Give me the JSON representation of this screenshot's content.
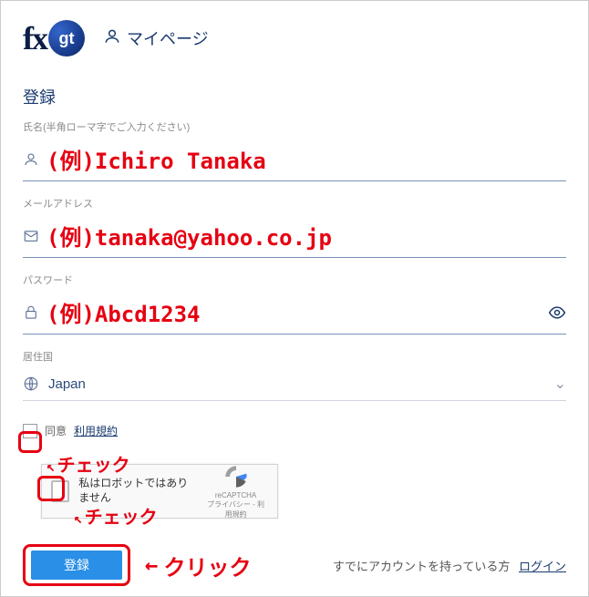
{
  "header": {
    "logo_fx": "fx",
    "logo_gt": "gt",
    "mypage_label": "マイページ"
  },
  "section_title": "登録",
  "fields": {
    "name": {
      "label": "氏名(半角ローマ字でご入力ください)",
      "example": "(例)Ichiro Tanaka"
    },
    "email": {
      "label": "メールアドレス",
      "example": "(例)tanaka@yahoo.co.jp"
    },
    "password": {
      "label": "パスワード",
      "example": "(例)Abcd1234"
    },
    "country": {
      "label": "居住国",
      "value": "Japan"
    }
  },
  "agree": {
    "agree_text": "同意",
    "terms_link": "利用規約"
  },
  "captcha": {
    "text": "私はロボットではありません",
    "brand": "reCAPTCHA",
    "privacy": "プライバシー - 利用規約"
  },
  "annotations": {
    "check": "チェック",
    "click": "クリック",
    "arrow": "←"
  },
  "footer": {
    "register_button": "登録",
    "already_text": "すでにアカウントを持っている方",
    "login_link": "ログイン"
  }
}
